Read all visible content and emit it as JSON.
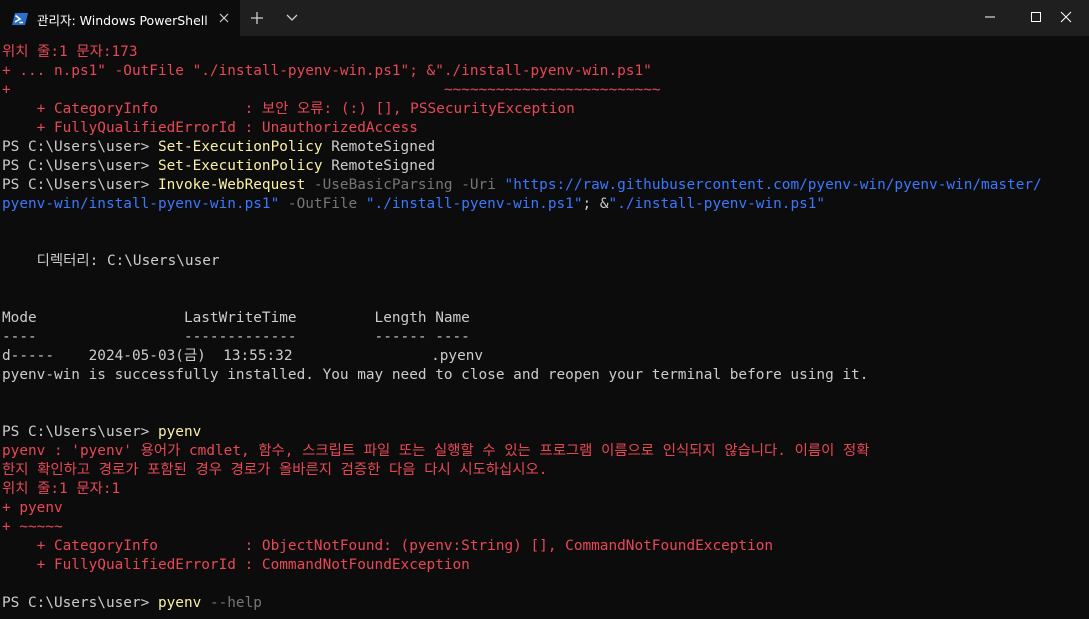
{
  "window": {
    "tab_title": "관리자: Windows PowerShell",
    "icons": {
      "tab_icon": "powershell-icon",
      "close_tab": "close-icon",
      "new_tab": "plus-icon",
      "dropdown": "chevron-down-icon",
      "minimize": "minimize-icon",
      "maximize": "maximize-icon",
      "close_window": "close-icon"
    }
  },
  "colors": {
    "background": "#0c0c0c",
    "titlebar": "#1f1f1f",
    "error": "#e74856",
    "command": "#f9f1a5",
    "parameter": "#767676",
    "string": "#3b78ff",
    "text": "#cccccc"
  },
  "terminal": {
    "lines": [
      {
        "segments": [
          {
            "c": "r",
            "t": "위치 줄:1 문자:173"
          }
        ]
      },
      {
        "segments": [
          {
            "c": "r",
            "t": "+ ... n.ps1\" -OutFile \"./install-pyenv-win.ps1\"; &\"./install-pyenv-win.ps1\""
          }
        ]
      },
      {
        "segments": [
          {
            "c": "r",
            "t": "+                                                  ~~~~~~~~~~~~~~~~~~~~~~~~~"
          }
        ]
      },
      {
        "segments": [
          {
            "c": "r",
            "t": "    + CategoryInfo          : 보안 오류: (:) [], PSSecurityException"
          }
        ]
      },
      {
        "segments": [
          {
            "c": "r",
            "t": "    + FullyQualifiedErrorId : UnauthorizedAccess"
          }
        ]
      },
      {
        "segments": [
          {
            "c": "w",
            "t": "PS C:\\Users\\user> "
          },
          {
            "c": "y",
            "t": "Set-ExecutionPolicy"
          },
          {
            "c": "w",
            "t": " RemoteSigned"
          }
        ]
      },
      {
        "segments": [
          {
            "c": "w",
            "t": "PS C:\\Users\\user> "
          },
          {
            "c": "y",
            "t": "Set-ExecutionPolicy"
          },
          {
            "c": "w",
            "t": " RemoteSigned"
          }
        ]
      },
      {
        "segments": [
          {
            "c": "w",
            "t": "PS C:\\Users\\user> "
          },
          {
            "c": "y",
            "t": "Invoke-WebRequest"
          },
          {
            "c": "g",
            "t": " -UseBasicParsing -Uri "
          },
          {
            "c": "b",
            "t": "\"https://raw.githubusercontent.com/pyenv-win/pyenv-win/master/"
          }
        ]
      },
      {
        "segments": [
          {
            "c": "b",
            "t": "pyenv-win/install-pyenv-win.ps1\""
          },
          {
            "c": "g",
            "t": " -OutFile "
          },
          {
            "c": "b",
            "t": "\"./install-pyenv-win.ps1\""
          },
          {
            "c": "w",
            "t": "; &"
          },
          {
            "c": "b",
            "t": "\"./install-pyenv-win.ps1\""
          }
        ]
      },
      {
        "segments": []
      },
      {
        "segments": []
      },
      {
        "segments": [
          {
            "c": "w",
            "t": "    디렉터리: C:\\Users\\user"
          }
        ]
      },
      {
        "segments": []
      },
      {
        "segments": []
      },
      {
        "segments": [
          {
            "c": "w",
            "t": "Mode                 LastWriteTime         Length Name"
          }
        ]
      },
      {
        "segments": [
          {
            "c": "w",
            "t": "----                 -------------         ------ ----"
          }
        ]
      },
      {
        "segments": [
          {
            "c": "w",
            "t": "d-----    2024-05-03(금)  13:55:32                .pyenv"
          }
        ]
      },
      {
        "segments": [
          {
            "c": "w",
            "t": "pyenv-win is successfully installed. You may need to close and reopen your terminal before using it."
          }
        ]
      },
      {
        "segments": []
      },
      {
        "segments": []
      },
      {
        "segments": [
          {
            "c": "w",
            "t": "PS C:\\Users\\user> "
          },
          {
            "c": "y",
            "t": "pyenv"
          }
        ]
      },
      {
        "segments": [
          {
            "c": "r",
            "t": "pyenv : 'pyenv' 용어가 cmdlet, 함수, 스크립트 파일 또는 실행할 수 있는 프로그램 이름으로 인식되지 않습니다. 이름이 정확"
          }
        ]
      },
      {
        "segments": [
          {
            "c": "r",
            "t": "한지 확인하고 경로가 포함된 경우 경로가 올바른지 검증한 다음 다시 시도하십시오."
          }
        ]
      },
      {
        "segments": [
          {
            "c": "r",
            "t": "위치 줄:1 문자:1"
          }
        ]
      },
      {
        "segments": [
          {
            "c": "r",
            "t": "+ pyenv"
          }
        ]
      },
      {
        "segments": [
          {
            "c": "r",
            "t": "+ ~~~~~"
          }
        ]
      },
      {
        "segments": [
          {
            "c": "r",
            "t": "    + CategoryInfo          : ObjectNotFound: (pyenv:String) [], CommandNotFoundException"
          }
        ]
      },
      {
        "segments": [
          {
            "c": "r",
            "t": "    + FullyQualifiedErrorId : CommandNotFoundException"
          }
        ]
      },
      {
        "segments": []
      },
      {
        "segments": [
          {
            "c": "w",
            "t": "PS C:\\Users\\user> "
          },
          {
            "c": "y",
            "t": "pyenv"
          },
          {
            "c": "g",
            "t": " --help"
          }
        ]
      }
    ]
  }
}
